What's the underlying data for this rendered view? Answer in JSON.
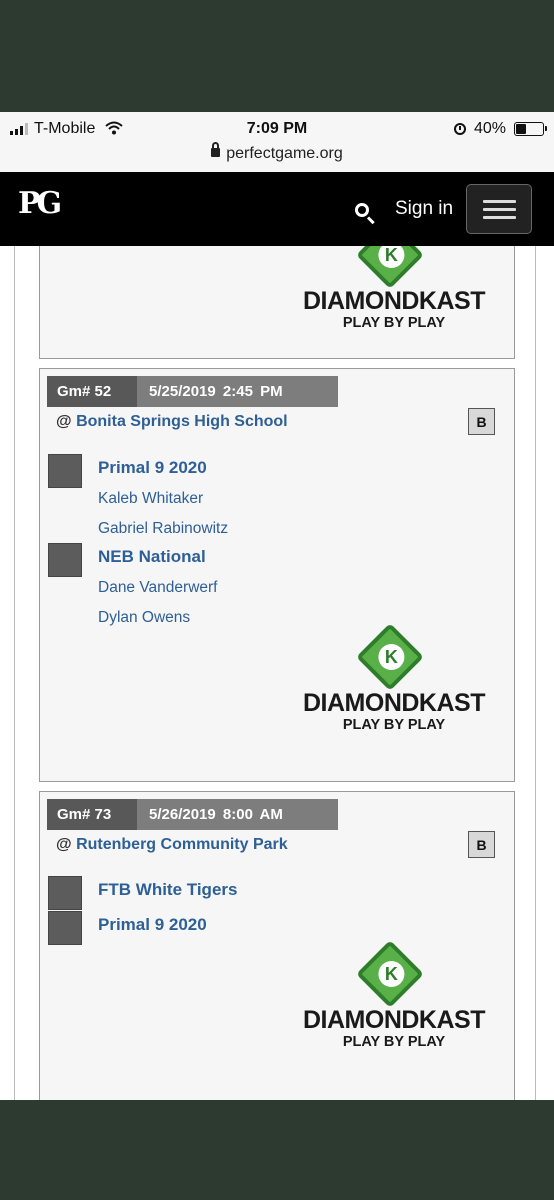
{
  "status_bar": {
    "carrier": "T-Mobile",
    "time": "7:09 PM",
    "battery": "40%",
    "url": "perfectgame.org",
    "battery_level": 0.4
  },
  "nav": {
    "logo": "PG",
    "sign_in": "Sign in"
  },
  "logo": {
    "word": "DIAMONDKAST",
    "tagline": "PLAY BY PLAY"
  },
  "games": [
    {
      "game_number": "Gm# 52",
      "date_time": "5/25/2019  2:45 PM",
      "at": "@",
      "venue": "Bonita Springs High School",
      "badge": "B",
      "teams": [
        {
          "name": "Primal 9 2020",
          "players": [
            "Kaleb Whitaker",
            "Gabriel Rabinowitz"
          ]
        },
        {
          "name": "NEB National",
          "players": [
            "Dane Vanderwerf",
            "Dylan Owens"
          ]
        }
      ]
    },
    {
      "game_number": "Gm# 73",
      "date_time": "5/26/2019  8:00 AM",
      "at": "@",
      "venue": "Rutenberg Community Park",
      "badge": "B",
      "teams": [
        {
          "name": "FTB White Tigers",
          "players": []
        },
        {
          "name": "Primal 9 2020",
          "players": []
        }
      ]
    }
  ]
}
